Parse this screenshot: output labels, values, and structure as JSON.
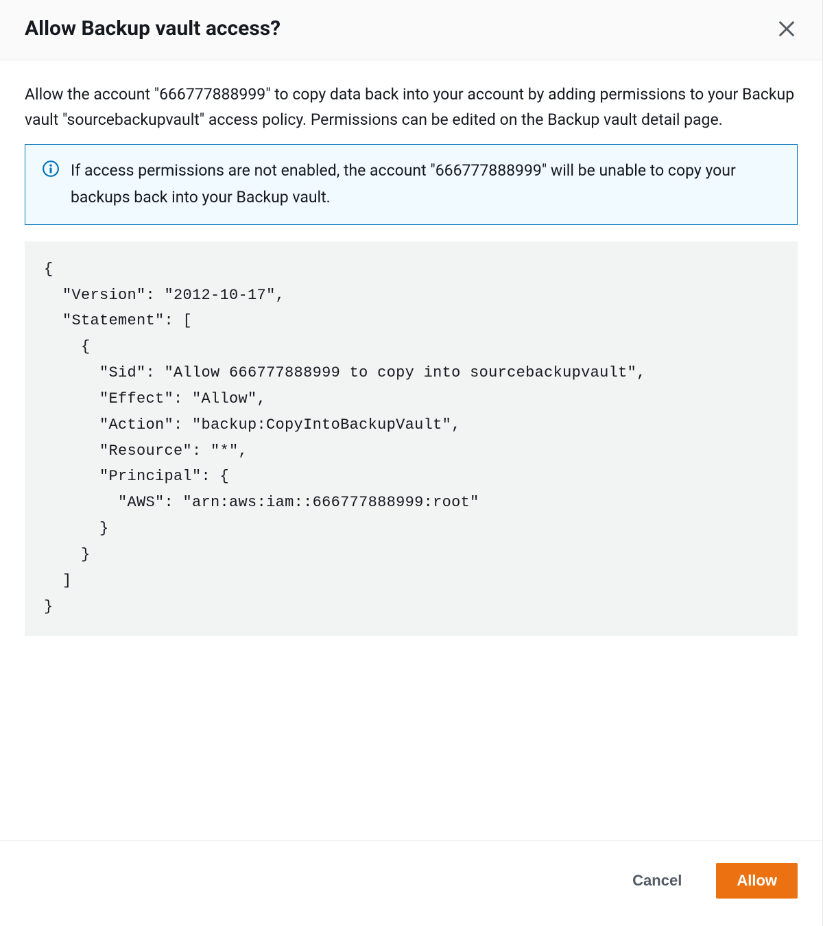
{
  "dialog": {
    "title": "Allow Backup vault access?",
    "description": "Allow the account \"666777888999\" to copy data back into your account by adding permissions to your Backup vault \"sourcebackupvault\" access policy. Permissions can be edited on the Backup vault detail page.",
    "info_text": "If access permissions are not enabled, the account \"666777888999\" will be unable to copy your backups back into your Backup vault.",
    "policy_json": "{\n  \"Version\": \"2012-10-17\",\n  \"Statement\": [\n    {\n      \"Sid\": \"Allow 666777888999 to copy into sourcebackupvault\",\n      \"Effect\": \"Allow\",\n      \"Action\": \"backup:CopyIntoBackupVault\",\n      \"Resource\": \"*\",\n      \"Principal\": {\n        \"AWS\": \"arn:aws:iam::666777888999:root\"\n      }\n    }\n  ]\n}",
    "cancel_label": "Cancel",
    "allow_label": "Allow"
  }
}
